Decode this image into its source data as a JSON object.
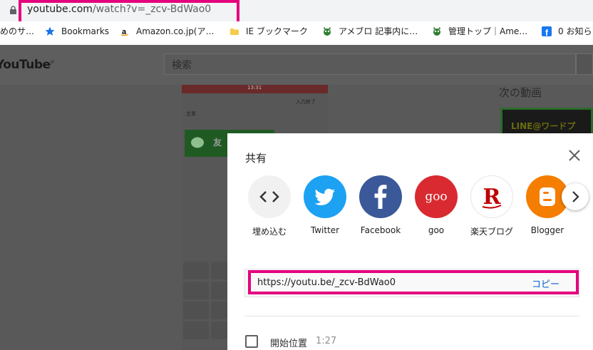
{
  "browser": {
    "url_host": "youtube.com",
    "url_path": "/watch?v=_zcv-BdWao0"
  },
  "bookmarks": [
    {
      "label": "めのサ…"
    },
    {
      "label": "Bookmarks"
    },
    {
      "label": "Amazon.co.jp(ア…"
    },
    {
      "label": "IE ブックマーク"
    },
    {
      "label": "アメブロ 記事内に…"
    },
    {
      "label": "管理トップ｜Ame…"
    },
    {
      "label": "0 お知ら"
    }
  ],
  "youtube": {
    "logo": "YouTube",
    "logo_region": "JP",
    "search_placeholder": "検索",
    "next_videos_title": "次の動画",
    "thumb_text": "LINE@ワードプ"
  },
  "video": {
    "time": "13:31",
    "input_done": "入力終了",
    "message_label": "文章",
    "button_text": "友"
  },
  "share_dialog": {
    "title": "共有",
    "options": [
      {
        "label": "埋め込む",
        "icon": "embed-icon",
        "color": "#f1f1f1"
      },
      {
        "label": "Twitter",
        "icon": "twitter-icon",
        "color": "#1da1f2"
      },
      {
        "label": "Facebook",
        "icon": "facebook-icon",
        "color": "#3b5998"
      },
      {
        "label": "goo",
        "icon": "goo-icon",
        "color": "#d82a30"
      },
      {
        "label": "楽天ブログ",
        "icon": "rakuten-icon",
        "color": "#ffffff"
      },
      {
        "label": "Blogger",
        "icon": "blogger-icon",
        "color": "#f57d00"
      }
    ],
    "share_url": "https://youtu.be/_zcv-BdWao0",
    "copy_label": "コピー",
    "start_label": "開始位置",
    "start_time": "1:27"
  },
  "colors": {
    "highlight": "#e5007e",
    "link_blue": "#065fd4"
  }
}
